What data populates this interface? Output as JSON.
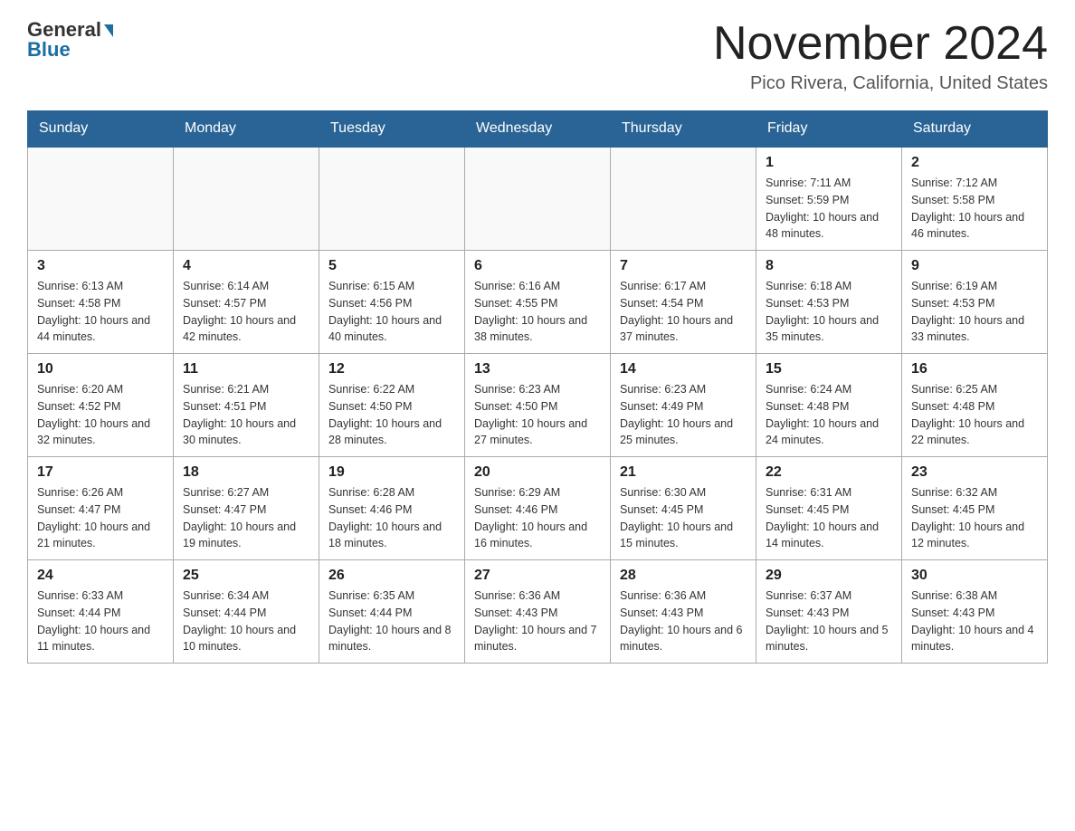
{
  "logo": {
    "general": "General",
    "blue": "Blue"
  },
  "header": {
    "month_title": "November 2024",
    "location": "Pico Rivera, California, United States"
  },
  "days_of_week": [
    "Sunday",
    "Monday",
    "Tuesday",
    "Wednesday",
    "Thursday",
    "Friday",
    "Saturday"
  ],
  "weeks": [
    [
      {
        "day": "",
        "info": ""
      },
      {
        "day": "",
        "info": ""
      },
      {
        "day": "",
        "info": ""
      },
      {
        "day": "",
        "info": ""
      },
      {
        "day": "",
        "info": ""
      },
      {
        "day": "1",
        "info": "Sunrise: 7:11 AM\nSunset: 5:59 PM\nDaylight: 10 hours and 48 minutes."
      },
      {
        "day": "2",
        "info": "Sunrise: 7:12 AM\nSunset: 5:58 PM\nDaylight: 10 hours and 46 minutes."
      }
    ],
    [
      {
        "day": "3",
        "info": "Sunrise: 6:13 AM\nSunset: 4:58 PM\nDaylight: 10 hours and 44 minutes."
      },
      {
        "day": "4",
        "info": "Sunrise: 6:14 AM\nSunset: 4:57 PM\nDaylight: 10 hours and 42 minutes."
      },
      {
        "day": "5",
        "info": "Sunrise: 6:15 AM\nSunset: 4:56 PM\nDaylight: 10 hours and 40 minutes."
      },
      {
        "day": "6",
        "info": "Sunrise: 6:16 AM\nSunset: 4:55 PM\nDaylight: 10 hours and 38 minutes."
      },
      {
        "day": "7",
        "info": "Sunrise: 6:17 AM\nSunset: 4:54 PM\nDaylight: 10 hours and 37 minutes."
      },
      {
        "day": "8",
        "info": "Sunrise: 6:18 AM\nSunset: 4:53 PM\nDaylight: 10 hours and 35 minutes."
      },
      {
        "day": "9",
        "info": "Sunrise: 6:19 AM\nSunset: 4:53 PM\nDaylight: 10 hours and 33 minutes."
      }
    ],
    [
      {
        "day": "10",
        "info": "Sunrise: 6:20 AM\nSunset: 4:52 PM\nDaylight: 10 hours and 32 minutes."
      },
      {
        "day": "11",
        "info": "Sunrise: 6:21 AM\nSunset: 4:51 PM\nDaylight: 10 hours and 30 minutes."
      },
      {
        "day": "12",
        "info": "Sunrise: 6:22 AM\nSunset: 4:50 PM\nDaylight: 10 hours and 28 minutes."
      },
      {
        "day": "13",
        "info": "Sunrise: 6:23 AM\nSunset: 4:50 PM\nDaylight: 10 hours and 27 minutes."
      },
      {
        "day": "14",
        "info": "Sunrise: 6:23 AM\nSunset: 4:49 PM\nDaylight: 10 hours and 25 minutes."
      },
      {
        "day": "15",
        "info": "Sunrise: 6:24 AM\nSunset: 4:48 PM\nDaylight: 10 hours and 24 minutes."
      },
      {
        "day": "16",
        "info": "Sunrise: 6:25 AM\nSunset: 4:48 PM\nDaylight: 10 hours and 22 minutes."
      }
    ],
    [
      {
        "day": "17",
        "info": "Sunrise: 6:26 AM\nSunset: 4:47 PM\nDaylight: 10 hours and 21 minutes."
      },
      {
        "day": "18",
        "info": "Sunrise: 6:27 AM\nSunset: 4:47 PM\nDaylight: 10 hours and 19 minutes."
      },
      {
        "day": "19",
        "info": "Sunrise: 6:28 AM\nSunset: 4:46 PM\nDaylight: 10 hours and 18 minutes."
      },
      {
        "day": "20",
        "info": "Sunrise: 6:29 AM\nSunset: 4:46 PM\nDaylight: 10 hours and 16 minutes."
      },
      {
        "day": "21",
        "info": "Sunrise: 6:30 AM\nSunset: 4:45 PM\nDaylight: 10 hours and 15 minutes."
      },
      {
        "day": "22",
        "info": "Sunrise: 6:31 AM\nSunset: 4:45 PM\nDaylight: 10 hours and 14 minutes."
      },
      {
        "day": "23",
        "info": "Sunrise: 6:32 AM\nSunset: 4:45 PM\nDaylight: 10 hours and 12 minutes."
      }
    ],
    [
      {
        "day": "24",
        "info": "Sunrise: 6:33 AM\nSunset: 4:44 PM\nDaylight: 10 hours and 11 minutes."
      },
      {
        "day": "25",
        "info": "Sunrise: 6:34 AM\nSunset: 4:44 PM\nDaylight: 10 hours and 10 minutes."
      },
      {
        "day": "26",
        "info": "Sunrise: 6:35 AM\nSunset: 4:44 PM\nDaylight: 10 hours and 8 minutes."
      },
      {
        "day": "27",
        "info": "Sunrise: 6:36 AM\nSunset: 4:43 PM\nDaylight: 10 hours and 7 minutes."
      },
      {
        "day": "28",
        "info": "Sunrise: 6:36 AM\nSunset: 4:43 PM\nDaylight: 10 hours and 6 minutes."
      },
      {
        "day": "29",
        "info": "Sunrise: 6:37 AM\nSunset: 4:43 PM\nDaylight: 10 hours and 5 minutes."
      },
      {
        "day": "30",
        "info": "Sunrise: 6:38 AM\nSunset: 4:43 PM\nDaylight: 10 hours and 4 minutes."
      }
    ]
  ]
}
